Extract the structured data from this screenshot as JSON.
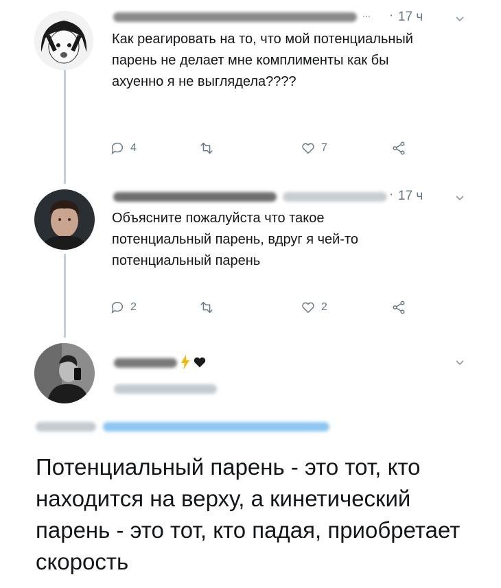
{
  "tweets": [
    {
      "time": "17 ч",
      "text": "Как реагировать на то, что мой потенциальный парень не делает мне комплименты как бы ахуенно я не выглядела????",
      "reply_count": "4",
      "like_count": "7"
    },
    {
      "time": "17 ч",
      "text": "Объясните пожалуйста что такое потенциальный парень, вдруг я чей-то потенциальный парень",
      "reply_count": "2",
      "like_count": "2"
    }
  ],
  "main_tweet": {
    "text": "Потенциальный парень - это тот, кто находится на верху, а кинетический парень - это тот, кто падая, приобретает скорость"
  },
  "colors": {
    "text": "#14171a",
    "muted": "#657786",
    "link": "#1da1f2",
    "thread_line": "#c4cfd6"
  }
}
